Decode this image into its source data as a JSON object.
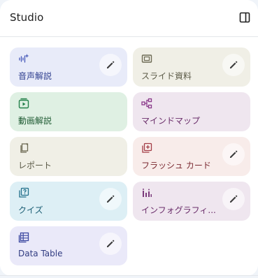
{
  "header": {
    "title": "Studio"
  },
  "icons": {
    "panel_toggle": "dock-panel-icon",
    "edit": "pencil-icon"
  },
  "cards": [
    {
      "label": "音声解説",
      "icon": "audio-sparkle-icon",
      "color": "#4457b8"
    },
    {
      "label": "スライド資料",
      "icon": "slides-icon",
      "color": "#6e6b55"
    },
    {
      "label": "動画解説",
      "icon": "video-icon",
      "color": "#23804a"
    },
    {
      "label": "マインドマップ",
      "icon": "mindmap-icon",
      "color": "#8a3a8a"
    },
    {
      "label": "レポート",
      "icon": "report-icon",
      "color": "#6e6b55"
    },
    {
      "label": "フラッシュ カード",
      "icon": "flashcards-icon",
      "color": "#a33c46"
    },
    {
      "label": "クイズ",
      "icon": "quiz-icon",
      "color": "#226f8a"
    },
    {
      "label": "インフォグラフィ...",
      "icon": "infographic-icon",
      "color": "#7b3a7b"
    },
    {
      "label": "Data Table",
      "icon": "table-icon",
      "color": "#3b48a0"
    }
  ]
}
